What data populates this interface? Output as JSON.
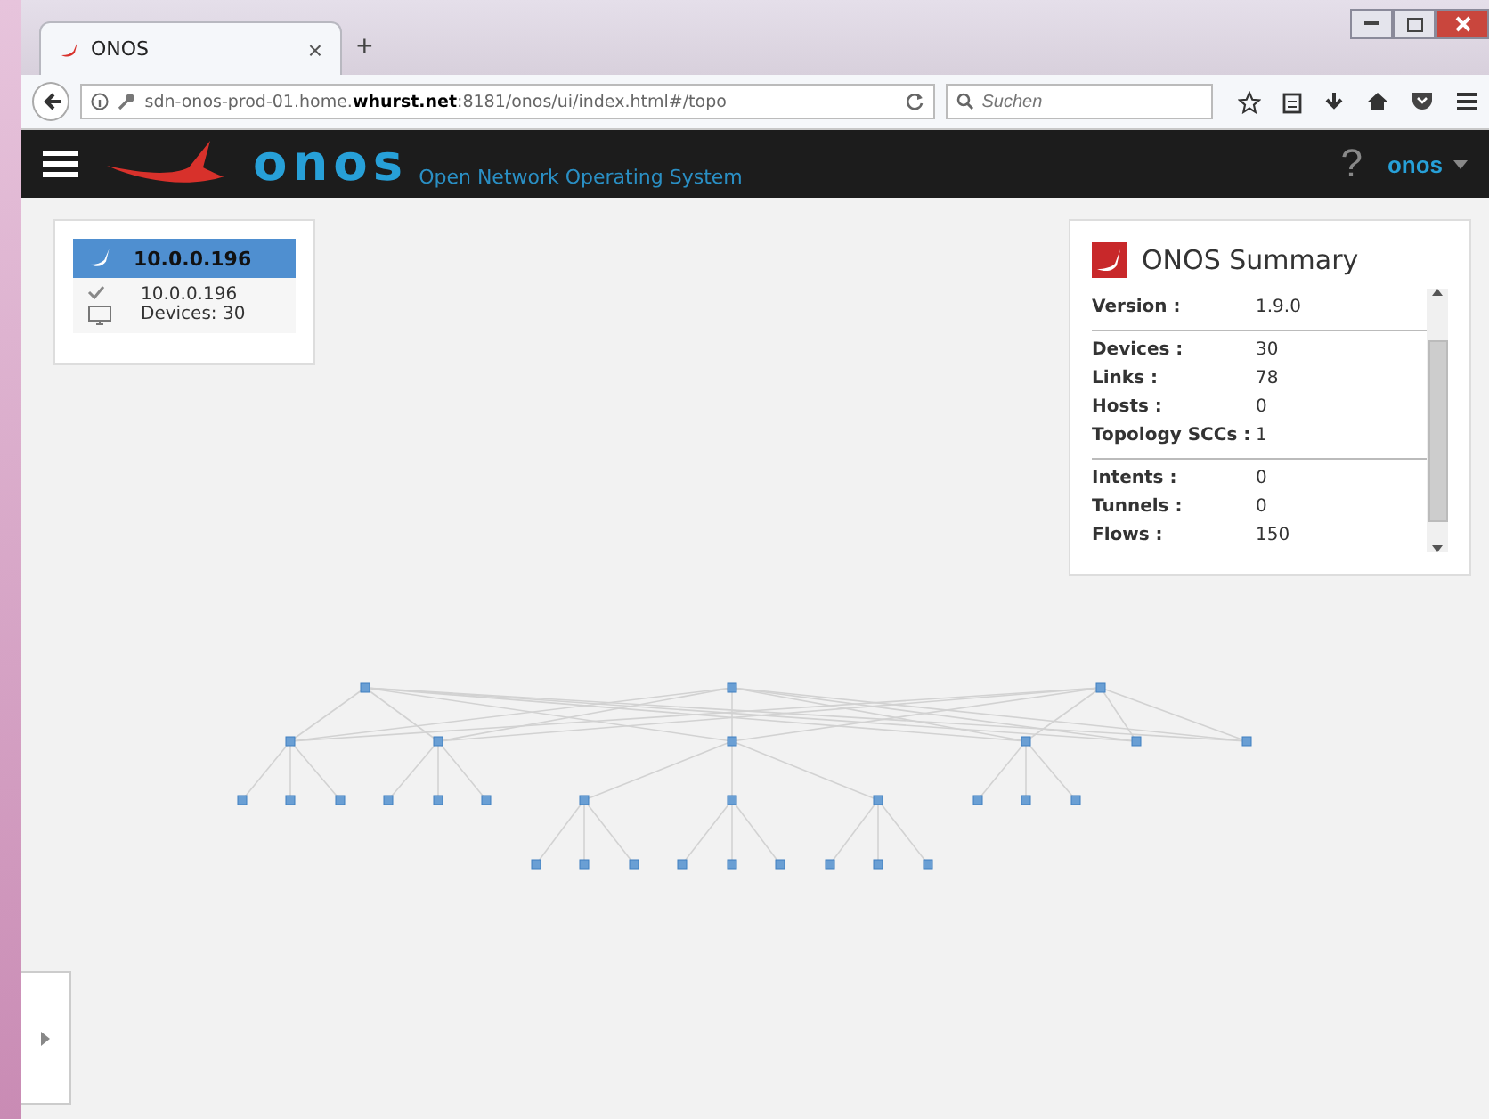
{
  "browser": {
    "tab": {
      "title": "ONOS",
      "close": "×",
      "selected": true
    },
    "new_tab": "+",
    "url": "sdn-onos-prod-01.home.**whurst.net**:8181/onos/ui/index.html#/topo",
    "search": {
      "placeholder": "Suchen"
    }
  },
  "header": {
    "logo": "onos",
    "tagline": "Open Network Operating System",
    "help": "?",
    "user": "onos"
  },
  "cluster_panel": {
    "title": "10.0.0.196",
    "members": [
      {
        "ip": "10.0.0.196",
        "devices": "Devices: 30",
        "online": true
      }
    ]
  },
  "summary": {
    "title": "ONOS Summary",
    "groups": [
      [
        {
          "label": "Version :",
          "value": "1.9.0"
        }
      ],
      [
        {
          "label": "Devices :",
          "value": "30"
        },
        {
          "label": "Links :",
          "value": "78"
        },
        {
          "label": "Hosts :",
          "value": "0"
        },
        {
          "label": "Topology SCCs :",
          "value": "1"
        }
      ],
      [
        {
          "label": "Intents :",
          "value": "0"
        },
        {
          "label": "Tunnels :",
          "value": "0"
        },
        {
          "label": "Flows :",
          "value": "150"
        }
      ]
    ]
  }
}
